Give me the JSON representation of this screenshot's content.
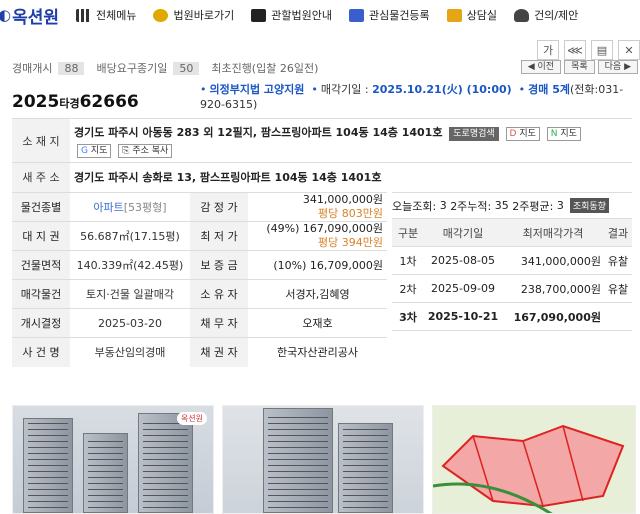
{
  "site": {
    "logo": "옥션원"
  },
  "nav": [
    "전체메뉴",
    "법원바로가기",
    "관할법원안내",
    "관심물건등록",
    "상담실",
    "건의/제안"
  ],
  "tools": [
    "가",
    "⋘",
    "▤",
    "✕"
  ],
  "stats": {
    "a_label": "경매개시",
    "a_val": "88",
    "b_label": "배당요구종기일",
    "b_val": "50",
    "c_text": "최초진행(입찰 26일전)"
  },
  "navbtns": [
    "◀ 이전",
    "목록",
    "다음 ▶"
  ],
  "case": {
    "year": "2025",
    "kind": "타경",
    "num": "62666",
    "court_label": "의정부지법 고양지원",
    "date_label": "매각기일 :",
    "date_val": "2025.10.21(火) (10:00)",
    "dept": "경매 5계",
    "phone": "(전화:031-920-6315)"
  },
  "location": {
    "label": "소 재 지",
    "addr": "경기도 파주시 아동동 283 외 12필지, 팜스프링아파트 104동 14층 1401호",
    "btn_road": "도로명검색",
    "btn_d": "지도",
    "btn_n": "지도",
    "btn_g": "지도",
    "btn_copy": "주소 복사"
  },
  "new_addr": {
    "label": "새 주 소",
    "addr": "경기도 파주시 송화로 13, 팜스프링아파트 104동 14층 1401호"
  },
  "rows": [
    {
      "l1": "물건종별",
      "v1": "아파트",
      "v1b": "[53평형]",
      "l2": "감 정 가",
      "v2": "341,000,000원",
      "v2b": "평당 803만원"
    },
    {
      "l1": "대 지 권",
      "v1": "56.687㎡(17.15평)",
      "v1b": "",
      "l2": "최 저 가",
      "v2": "(49%) 167,090,000원",
      "v2b": "평당 394만원"
    },
    {
      "l1": "건물면적",
      "v1": "140.339㎡(42.45평)",
      "v1b": "",
      "l2": "보 증 금",
      "v2": "(10%) 16,709,000원",
      "v2b": ""
    },
    {
      "l1": "매각물건",
      "v1": "토지·건물 일괄매각",
      "v1b": "",
      "l2": "소 유 자",
      "v2": "서경자,김혜영",
      "v2b": ""
    },
    {
      "l1": "개시결정",
      "v1": "2025-03-20",
      "v1b": "",
      "l2": "채 무 자",
      "v2": "오재호",
      "v2b": ""
    },
    {
      "l1": "사 건 명",
      "v1": "부동산임의경매",
      "v1b": "",
      "l2": "채 권 자",
      "v2": "한국자산관리공사",
      "v2b": ""
    }
  ],
  "views": {
    "today_label": "오늘조회:",
    "today": "3",
    "week_label": "2주누적:",
    "week": "35",
    "avg_label": "2주평균:",
    "avg": "3",
    "btn": "조회동향"
  },
  "history": {
    "headers": [
      "구분",
      "매각기일",
      "최저매각가격",
      "결과"
    ],
    "rows": [
      {
        "n": "1차",
        "date": "2025-08-05",
        "price": "341,000,000원",
        "res": "유찰"
      },
      {
        "n": "2차",
        "date": "2025-09-09",
        "price": "238,700,000원",
        "res": "유찰"
      },
      {
        "n": "3차",
        "date": "2025-10-21",
        "price": "167,090,000원",
        "res": ""
      }
    ]
  },
  "photo_badge": "옥션원"
}
